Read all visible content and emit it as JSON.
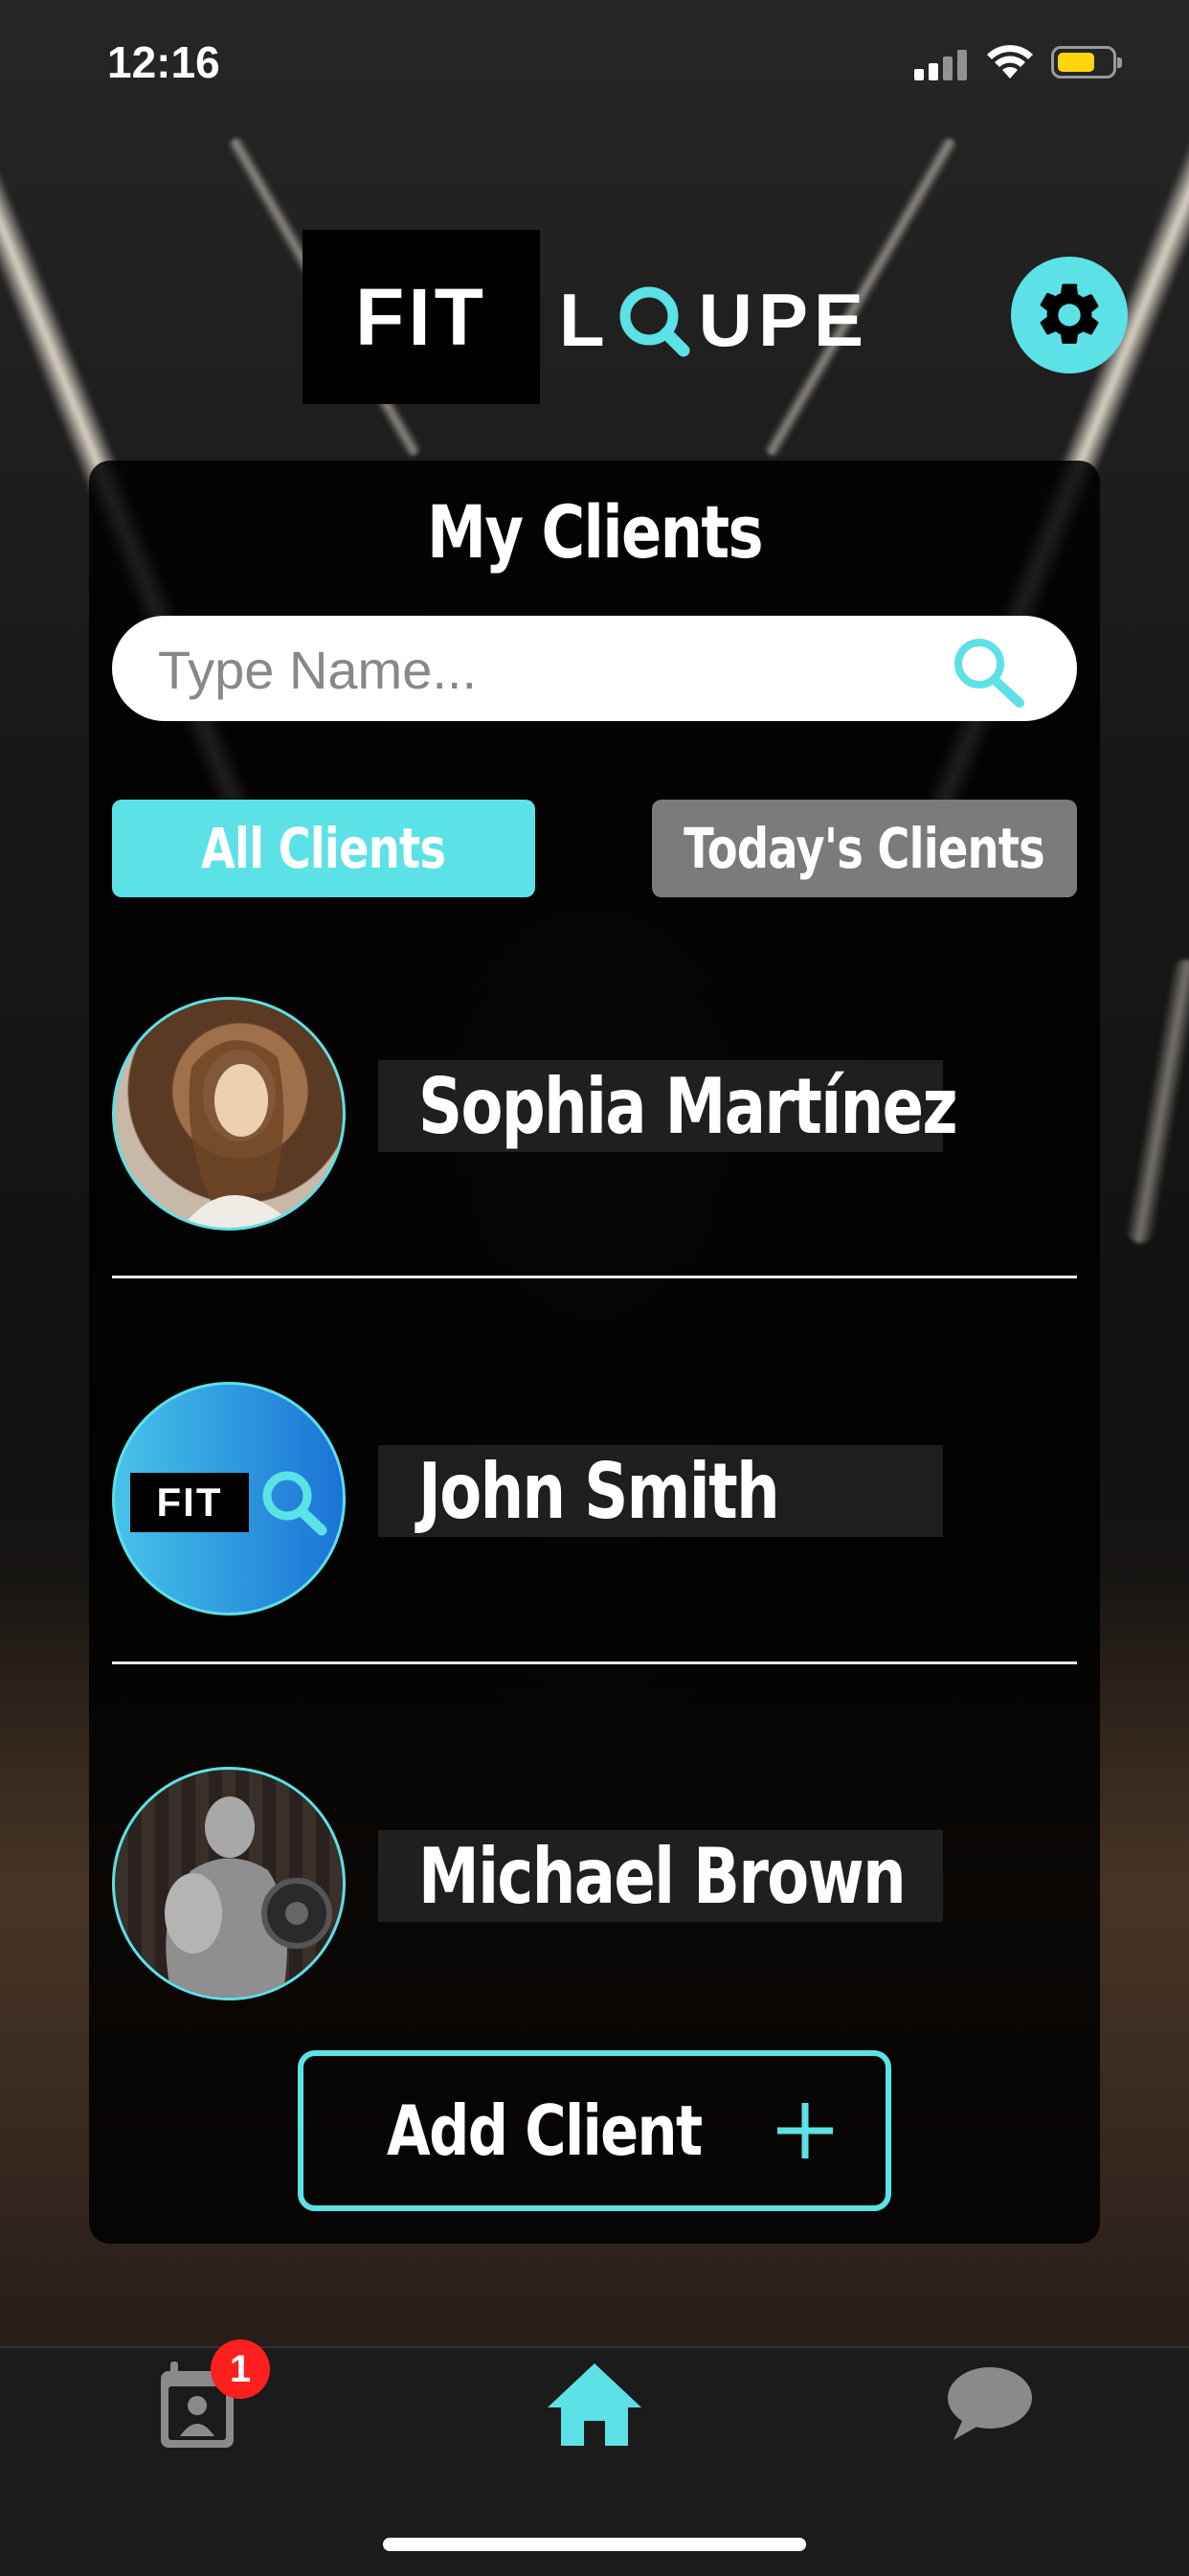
{
  "status_bar": {
    "time": "12:16"
  },
  "brand": {
    "logo_left": "FIT",
    "logo_right_prefix": "L",
    "logo_right_suffix": "UPE",
    "accent_color": "#5ce1e6"
  },
  "header": {
    "settings_icon": "gear-icon"
  },
  "panel": {
    "title": "My Clients",
    "search": {
      "placeholder": "Type Name...",
      "value": ""
    },
    "tabs": [
      {
        "label": "All Clients",
        "active": true
      },
      {
        "label": "Today's Clients",
        "active": false
      }
    ],
    "clients": [
      {
        "name": "Sophia Martínez",
        "avatar": "photo"
      },
      {
        "name": "John Smith",
        "avatar": "fitloupe-default"
      },
      {
        "name": "Michael Brown",
        "avatar": "photo"
      }
    ],
    "default_avatar_text": "FIT",
    "add_button_label": "Add Client"
  },
  "tab_bar": {
    "items": [
      {
        "icon": "calendar-contact-icon",
        "badge": "1"
      },
      {
        "icon": "home-icon",
        "active": true
      },
      {
        "icon": "chat-bubble-icon"
      }
    ]
  }
}
